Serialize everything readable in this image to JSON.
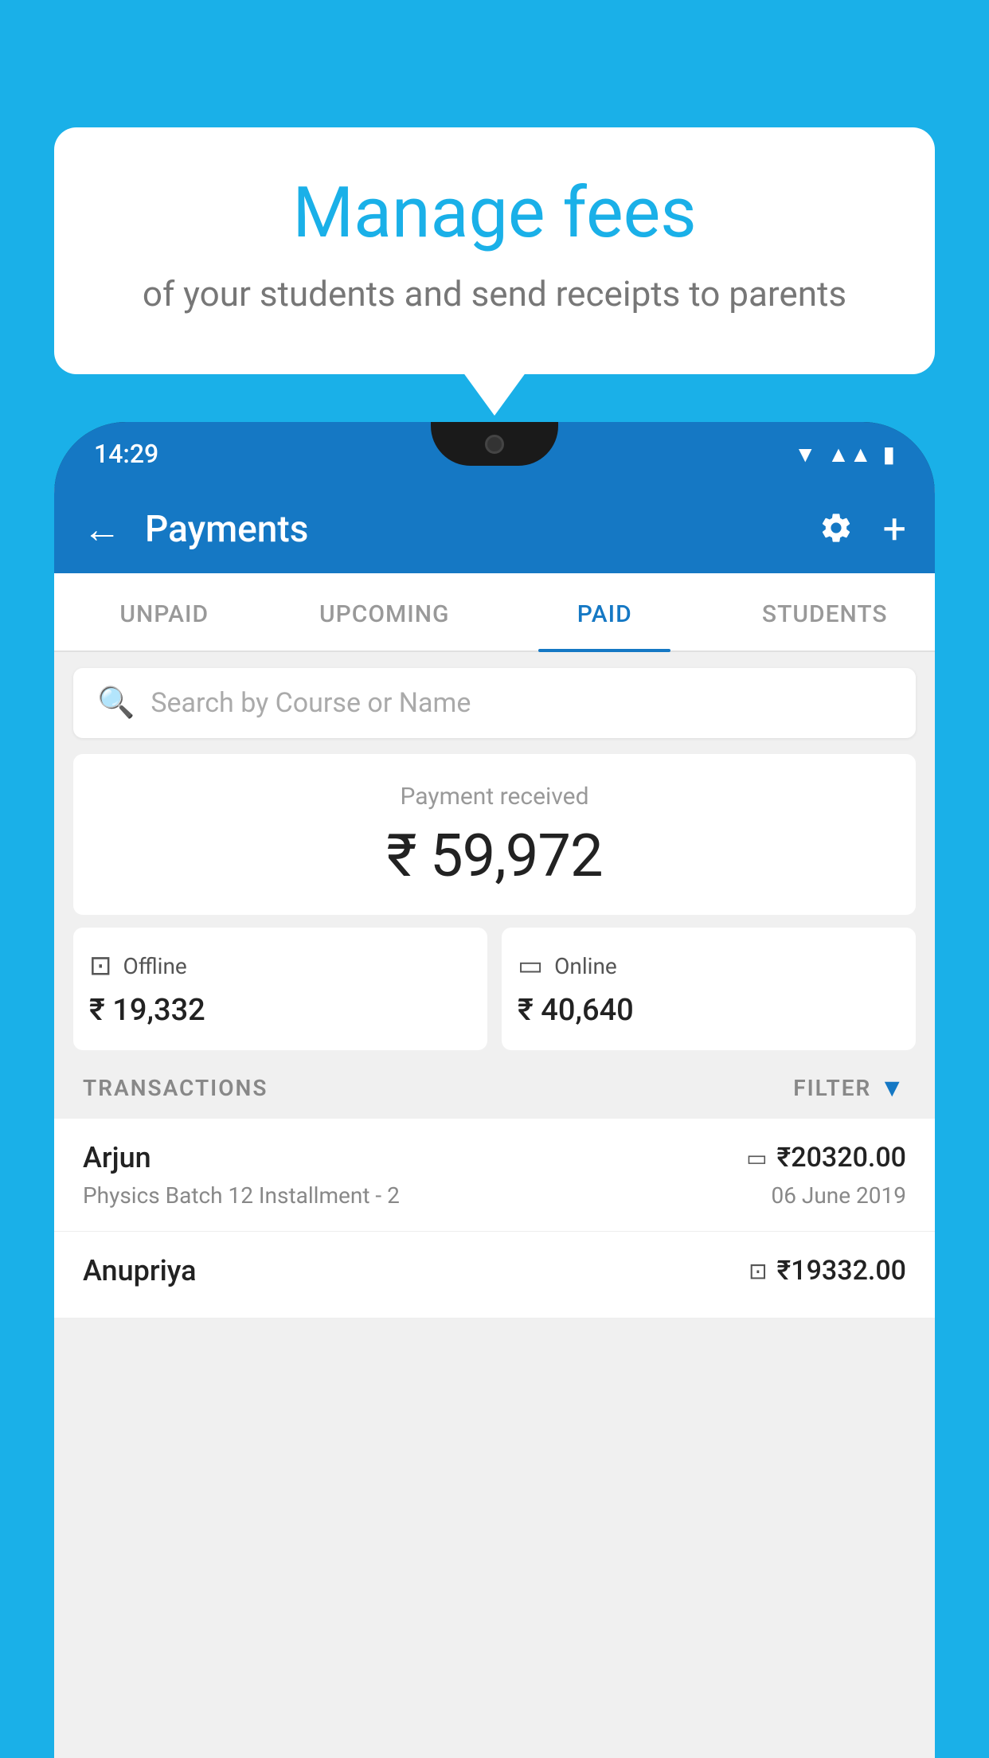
{
  "page": {
    "background_color": "#1ab0e8"
  },
  "bubble": {
    "title": "Manage fees",
    "subtitle": "of your students and send receipts to parents"
  },
  "status_bar": {
    "time": "14:29",
    "wifi_icon": "wifi",
    "signal_icon": "signal",
    "battery_icon": "battery"
  },
  "header": {
    "back_label": "←",
    "title": "Payments",
    "settings_icon": "gear-icon",
    "add_icon": "plus-icon"
  },
  "tabs": [
    {
      "label": "UNPAID",
      "active": false
    },
    {
      "label": "UPCOMING",
      "active": false
    },
    {
      "label": "PAID",
      "active": true
    },
    {
      "label": "STUDENTS",
      "active": false
    }
  ],
  "search": {
    "placeholder": "Search by Course or Name"
  },
  "payment_received": {
    "label": "Payment received",
    "amount": "₹ 59,972",
    "offline": {
      "label": "Offline",
      "amount": "₹ 19,332"
    },
    "online": {
      "label": "Online",
      "amount": "₹ 40,640"
    }
  },
  "transactions_section": {
    "label": "TRANSACTIONS",
    "filter_label": "FILTER"
  },
  "transactions": [
    {
      "name": "Arjun",
      "course": "Physics Batch 12 Installment - 2",
      "amount": "₹20320.00",
      "date": "06 June 2019",
      "payment_type": "card"
    },
    {
      "name": "Anupriya",
      "course": "",
      "amount": "₹19332.00",
      "date": "",
      "payment_type": "rupee"
    }
  ]
}
